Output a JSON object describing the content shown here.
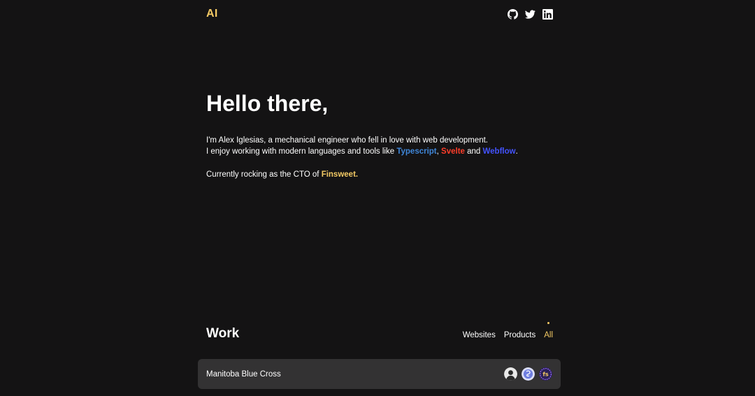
{
  "header": {
    "logo": "AI",
    "social_icons": [
      "github-icon",
      "twitter-icon",
      "linkedin-icon"
    ]
  },
  "hero": {
    "title": "Hello there,",
    "line1": "I'm Alex Iglesias, a mechanical engineer who fell in love with web development.",
    "line2_prefix": "I enjoy working with modern languages and tools like ",
    "tools": [
      {
        "label": "Typescript",
        "color": "#3f86d8"
      },
      {
        "label": "Svelte",
        "color": "#ff3e2a"
      },
      {
        "label": "Webflow",
        "color": "#4353ff"
      }
    ],
    "sep_comma": ", ",
    "sep_and": " and ",
    "line2_suffix": ".",
    "cto_prefix": "Currently rocking as the CTO of ",
    "company": "Finsweet.",
    "company_color": "#f3c964"
  },
  "work": {
    "title": "Work",
    "filters": [
      {
        "label": "Websites",
        "active": false
      },
      {
        "label": "Products",
        "active": false
      },
      {
        "label": "All",
        "active": true
      }
    ],
    "items": [
      {
        "title": "Manitoba Blue Cross",
        "avatars": [
          "person-avatar",
          "svelte-avatar",
          "finsweet-avatar"
        ]
      }
    ]
  },
  "colors": {
    "background": "#141314",
    "accent": "#f3c964",
    "card": "#333233"
  }
}
